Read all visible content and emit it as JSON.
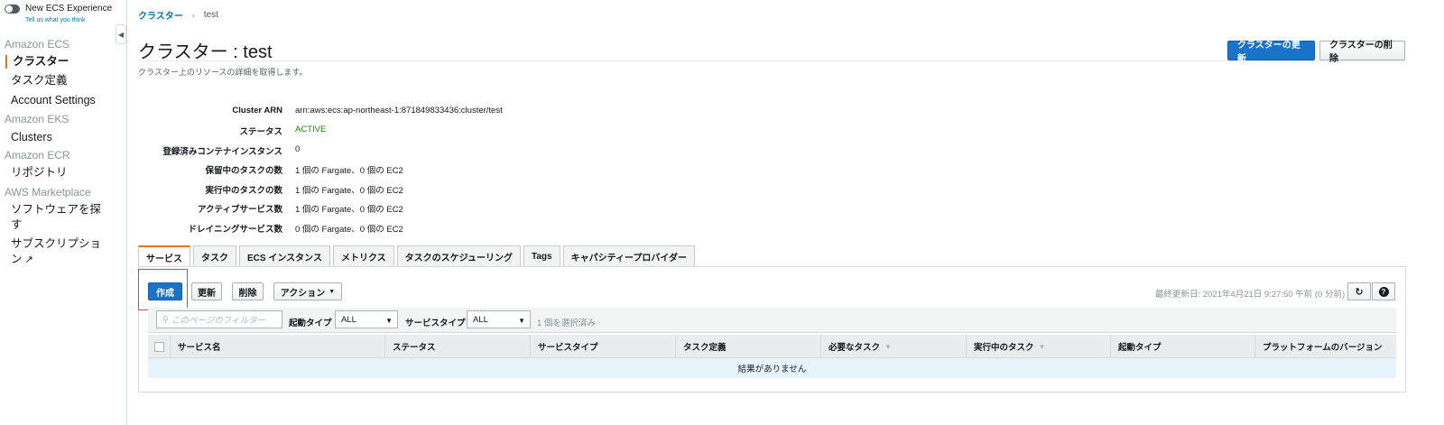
{
  "sidebar": {
    "toggle_label": "New ECS Experience",
    "feedback_link": "Tell us what you think",
    "groups": [
      {
        "label": "Amazon ECS"
      },
      {
        "label": "Amazon EKS"
      },
      {
        "label": "Amazon ECR"
      },
      {
        "label": "AWS Marketplace"
      }
    ],
    "items": [
      {
        "label": "クラスター"
      },
      {
        "label": "タスク定義"
      },
      {
        "label": "Account Settings"
      },
      {
        "label": "Clusters"
      },
      {
        "label": "リポジトリ"
      },
      {
        "label": "ソフトウェアを探す"
      },
      {
        "label": "サブスクリプション"
      }
    ]
  },
  "breadcrumb": {
    "parent": "クラスター",
    "current": "test"
  },
  "header": {
    "title": "クラスター : test",
    "description": "クラスター上のリソースの詳細を取得します。",
    "update_button": "クラスターの更新",
    "delete_button": "クラスターの削除"
  },
  "details": [
    {
      "label": "Cluster ARN",
      "value": "arn:aws:ecs:ap-northeast-1:871849833436:cluster/test"
    },
    {
      "label": "ステータス",
      "value": "ACTIVE"
    },
    {
      "label": "登録済みコンテナインスタンス",
      "value": "0"
    },
    {
      "label": "保留中のタスクの数",
      "value": "1 個の Fargate、0 個の EC2"
    },
    {
      "label": "実行中のタスクの数",
      "value": "1 個の Fargate、0 個の EC2"
    },
    {
      "label": "アクティブサービス数",
      "value": "1 個の Fargate、0 個の EC2"
    },
    {
      "label": "ドレイニングサービス数",
      "value": "0 個の Fargate、0 個の EC2"
    }
  ],
  "tabs": [
    {
      "label": "サービス",
      "active": true
    },
    {
      "label": "タスク"
    },
    {
      "label": "ECS インスタンス"
    },
    {
      "label": "メトリクス"
    },
    {
      "label": "タスクのスケジューリング"
    },
    {
      "label": "Tags"
    },
    {
      "label": "キャパシティープロバイダー"
    }
  ],
  "toolbar": {
    "create": "作成",
    "update": "更新",
    "delete": "削除",
    "actions": "アクション",
    "last_updated": "最終更新日: 2021年4月21日 9:27:50 午前 (0 分前)",
    "refresh_icon": "refresh-icon",
    "help_icon": "help-icon"
  },
  "filter": {
    "placeholder": "このページのフィルター",
    "launch_type_label": "起動タイプ",
    "launch_type_value": "ALL",
    "service_type_label": "サービスタイプ",
    "service_type_value": "ALL",
    "selected_count": "1 個を選択済み"
  },
  "table": {
    "columns": [
      "サービス名",
      "ステータス",
      "サービスタイプ",
      "タスク定義",
      "必要なタスク",
      "実行中のタスク",
      "起動タイプ",
      "プラットフォームのバージョン"
    ],
    "empty_message": "結果がありません"
  },
  "colors": {
    "accent": "#ec7211",
    "primary": "#1a73c9",
    "link": "#0073bb",
    "active_status": "#1d8102"
  }
}
